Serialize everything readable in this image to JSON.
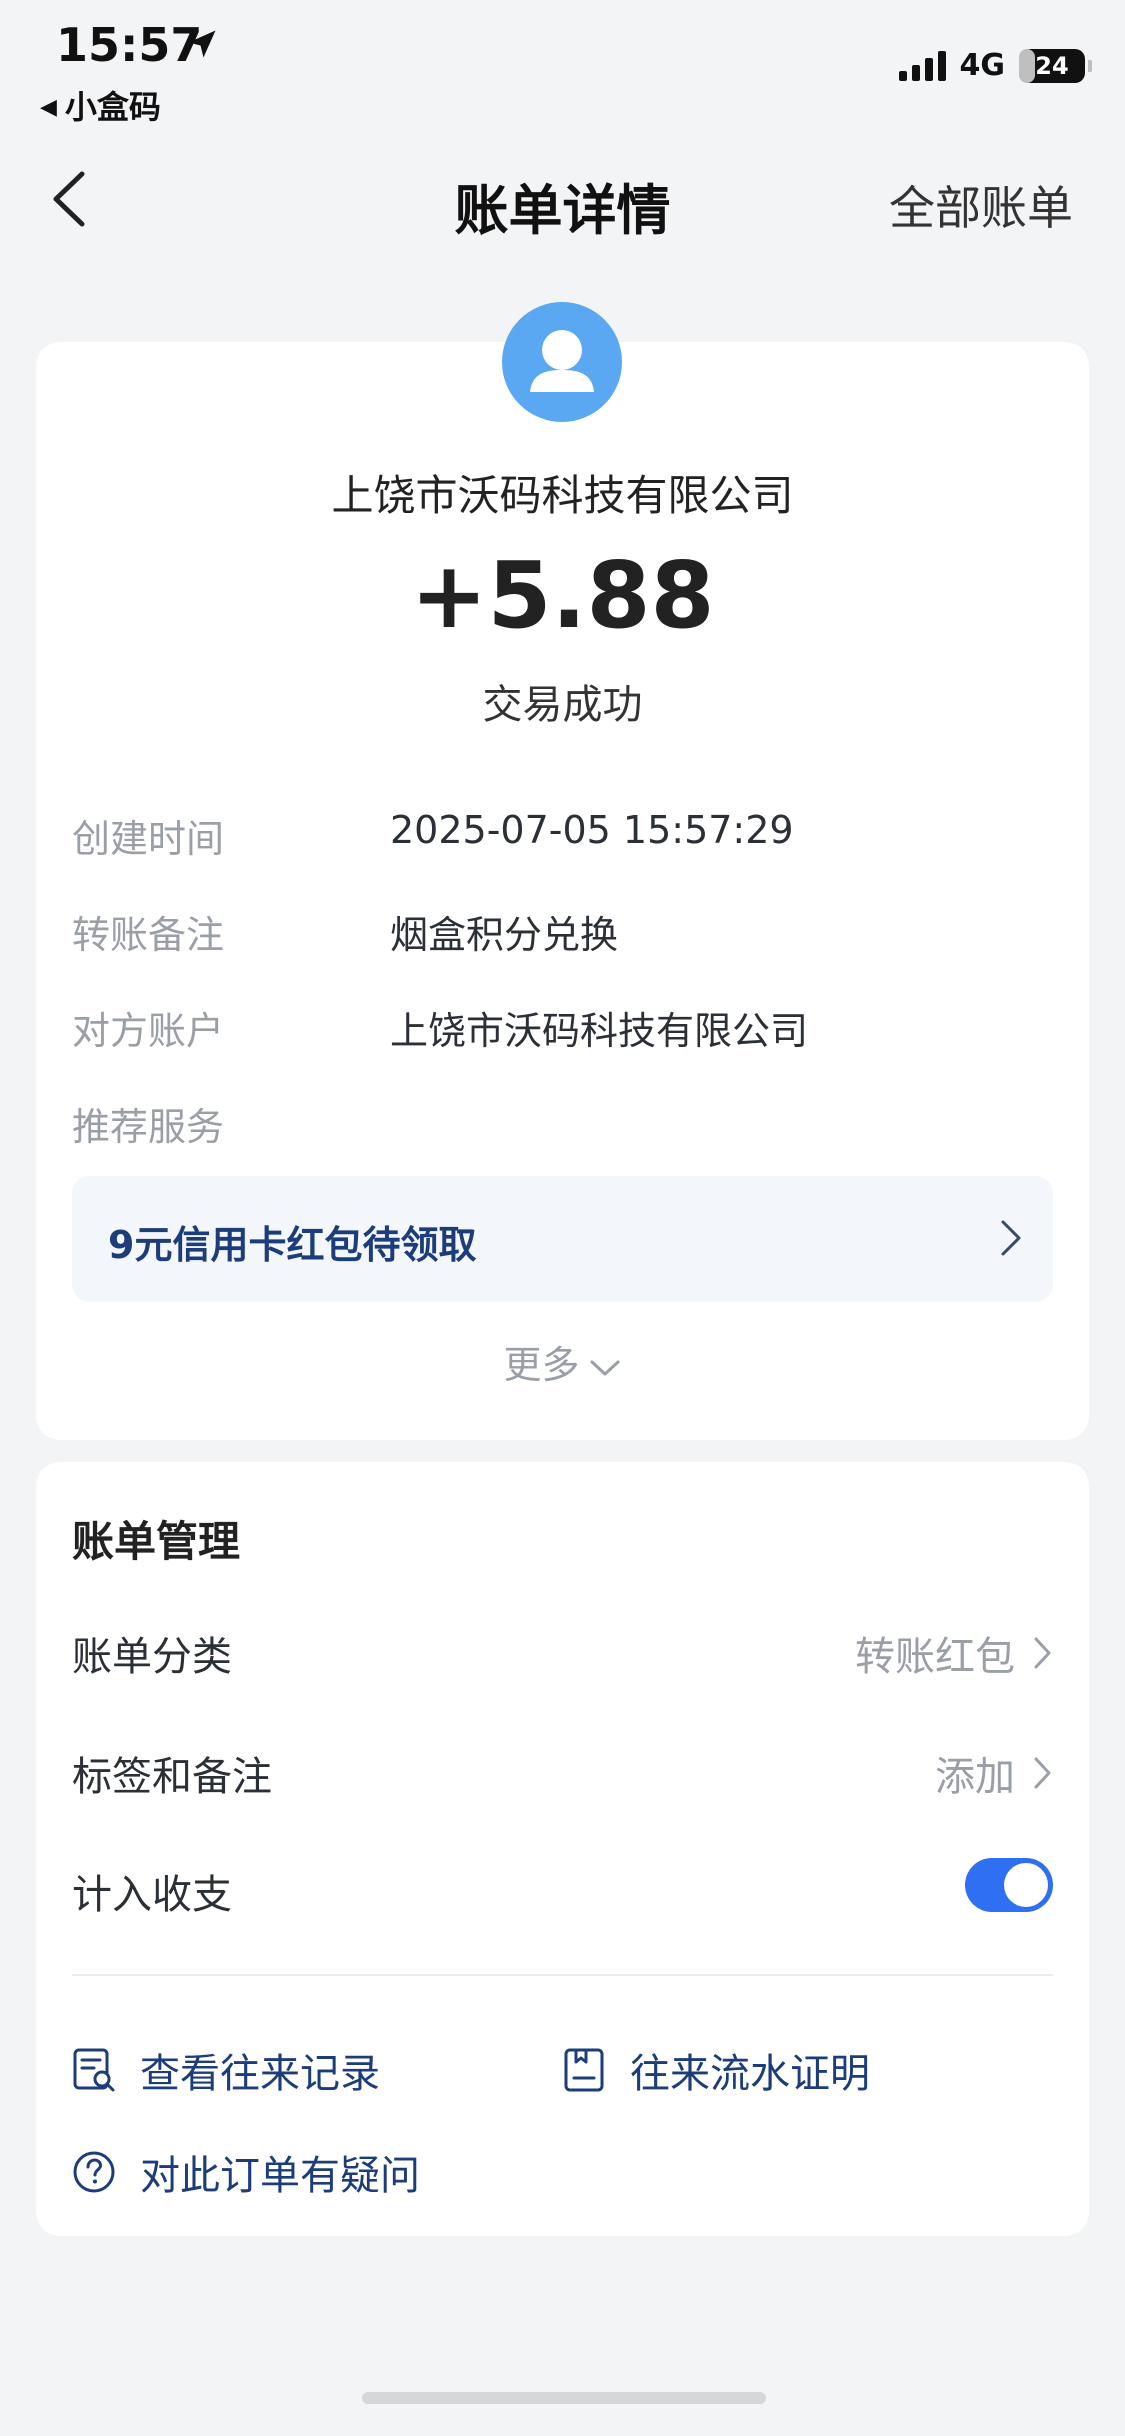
{
  "status_bar": {
    "time": "15:57",
    "back_app": "小盒码",
    "network": "4G",
    "battery": "24",
    "battery_level_percent": 24
  },
  "nav": {
    "title": "账单详情",
    "right_action": "全部账单"
  },
  "transaction": {
    "counterparty": "上饶市沃码科技有限公司",
    "amount": "+5.88",
    "status": "交易成功",
    "details": [
      {
        "label": "创建时间",
        "value": "2025-07-05 15:57:29"
      },
      {
        "label": "转账备注",
        "value": "烟盒积分兑换"
      },
      {
        "label": "对方账户",
        "value": "上饶市沃码科技有限公司"
      },
      {
        "label": "推荐服务",
        "value": ""
      }
    ],
    "promo": "9元信用卡红包待领取",
    "more": "更多"
  },
  "management": {
    "title": "账单管理",
    "rows": [
      {
        "label": "账单分类",
        "value": "转账红包"
      },
      {
        "label": "标签和备注",
        "value": "添加"
      },
      {
        "label": "计入收支",
        "value": "",
        "toggle_on": true
      }
    ],
    "links": [
      {
        "label": "查看往来记录",
        "icon": "record-search-icon"
      },
      {
        "label": "往来流水证明",
        "icon": "statement-icon"
      },
      {
        "label": "对此订单有疑问",
        "icon": "question-icon"
      }
    ]
  },
  "colors": {
    "accent": "#2f6ff1",
    "avatar": "#5aa7f2",
    "link": "#1c3d7a",
    "muted": "#9a9ea6",
    "background": "#f3f4f6"
  }
}
